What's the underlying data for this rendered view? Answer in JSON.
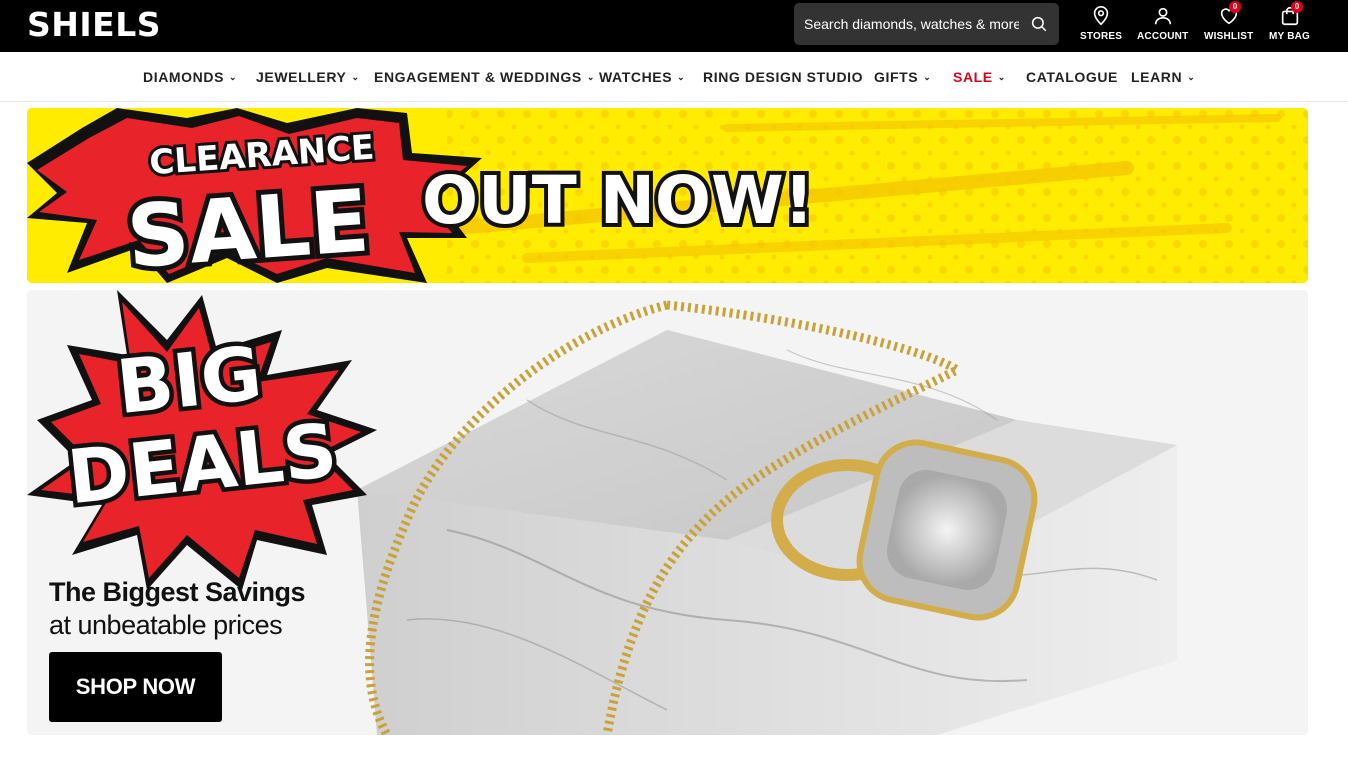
{
  "header": {
    "logo": "SHIELS",
    "search_placeholder": "Search diamonds, watches & more..",
    "icons": [
      {
        "label": "STORES",
        "icon": "map-pin-icon"
      },
      {
        "label": "ACCOUNT",
        "icon": "user-icon"
      },
      {
        "label": "WISHLIST",
        "icon": "heart-icon",
        "badge": "0"
      },
      {
        "label": "MY BAG",
        "icon": "bag-icon",
        "badge": "0"
      }
    ]
  },
  "nav": {
    "items": [
      {
        "label": "DIAMONDS",
        "dropdown": true
      },
      {
        "label": "JEWELLERY",
        "dropdown": true
      },
      {
        "label": "ENGAGEMENT & WEDDINGS",
        "dropdown": true
      },
      {
        "label": "WATCHES",
        "dropdown": true
      },
      {
        "label": "RING DESIGN STUDIO",
        "dropdown": false
      },
      {
        "label": "GIFTS",
        "dropdown": true
      },
      {
        "label": "SALE",
        "dropdown": true
      },
      {
        "label": "CATALOGUE",
        "dropdown": false
      },
      {
        "label": "LEARN",
        "dropdown": true
      }
    ]
  },
  "clearance_banner": {
    "line1": "CLEARANCE",
    "line2": "SALE",
    "line3": "OUT NOW!"
  },
  "hero": {
    "burst_line1": "BIG",
    "burst_line2": "DEALS",
    "tagline_bold": "The Biggest Savings",
    "tagline_regular": "at unbeatable prices",
    "cta": "SHOP NOW"
  },
  "colors": {
    "brand_black": "#000000",
    "sale_red": "#e0001b",
    "banner_yellow": "#ffeb00",
    "burst_red": "#e8232a"
  }
}
